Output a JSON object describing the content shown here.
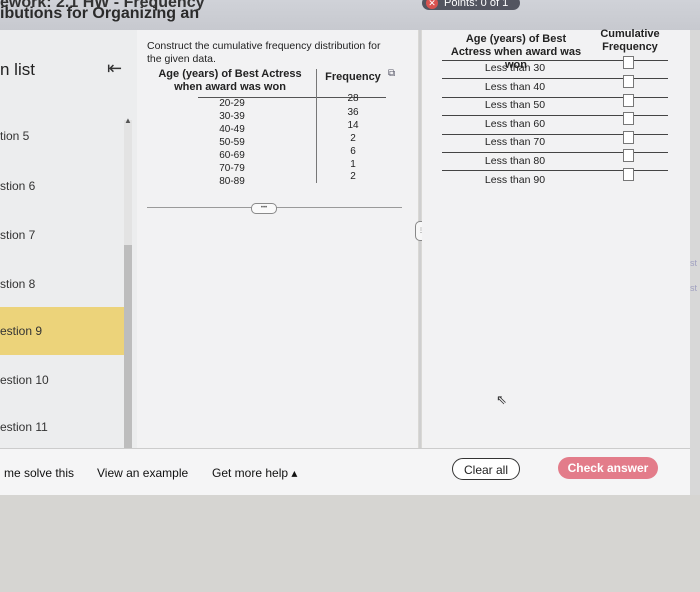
{
  "header": {
    "course_title": "ework: 2.1 HW - Frequency",
    "course_sub": "ibutions for Organizing an",
    "points": "Points: 0 of 1"
  },
  "sidebar": {
    "title": "n list",
    "items": [
      {
        "label": "tion 5"
      },
      {
        "label": "stion 6"
      },
      {
        "label": "stion 7"
      },
      {
        "label": "stion 8"
      },
      {
        "label": "estion 9",
        "active": true
      },
      {
        "label": "estion 10"
      },
      {
        "label": "estion 11"
      }
    ]
  },
  "question": {
    "instructions": "Construct the cumulative frequency distribution for the given data.",
    "given_table": {
      "col_age": "Age (years) of Best Actress when award was won",
      "col_freq": "Frequency",
      "rows": [
        {
          "age": "20-29",
          "freq": "28"
        },
        {
          "age": "30-39",
          "freq": "36"
        },
        {
          "age": "40-49",
          "freq": "14"
        },
        {
          "age": "50-59",
          "freq": "2"
        },
        {
          "age": "60-69",
          "freq": "6"
        },
        {
          "age": "70-79",
          "freq": "1"
        },
        {
          "age": "80-89",
          "freq": "2"
        }
      ]
    }
  },
  "answer_table": {
    "col_age": "Age (years) of Best Actress when award was won",
    "col_cum": "Cumulative Frequency",
    "rows": [
      {
        "label": "Less than 30",
        "value": ""
      },
      {
        "label": "Less than 40",
        "value": ""
      },
      {
        "label": "Less than 50",
        "value": ""
      },
      {
        "label": "Less than 60",
        "value": ""
      },
      {
        "label": "Less than 70",
        "value": ""
      },
      {
        "label": "Less than 80",
        "value": ""
      },
      {
        "label": "Less than 90",
        "value": ""
      }
    ]
  },
  "footer": {
    "help_solve": "me solve this",
    "view_example": "View an example",
    "get_more_help": "Get more help ▴",
    "clear_all": "Clear all",
    "check_answer": "Check answer"
  },
  "edge": {
    "st1": "st",
    "st2": "st"
  }
}
